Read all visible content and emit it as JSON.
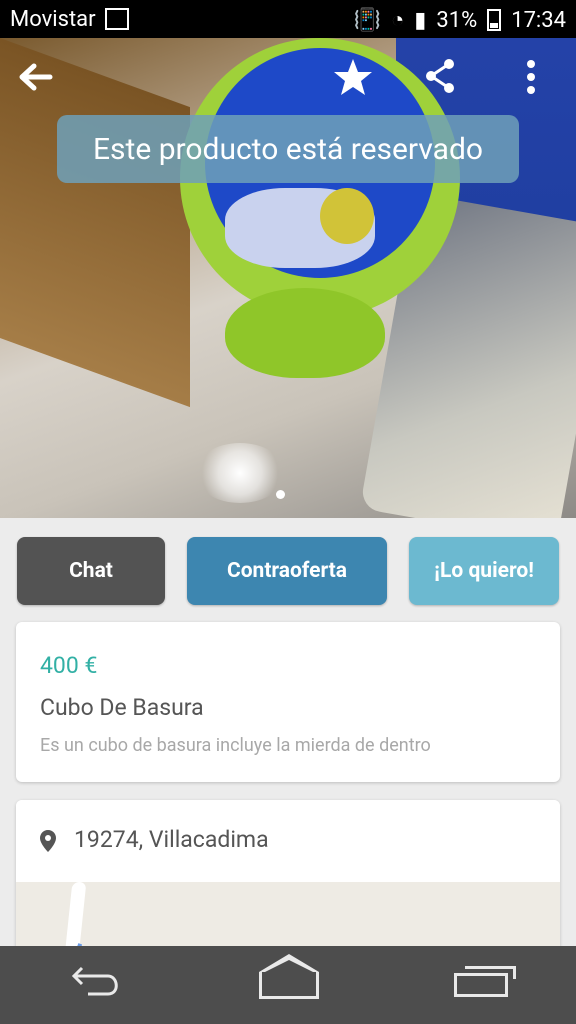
{
  "status_bar": {
    "carrier": "Movistar",
    "battery_percent": "31%",
    "time": "17:34"
  },
  "header": {
    "reserved_banner": "Este producto está reservado",
    "icons": [
      "back-arrow-icon",
      "star-icon",
      "share-icon",
      "more-vert-icon"
    ]
  },
  "actions": {
    "chat_label": "Chat",
    "counteroffer_label": "Contraoferta",
    "want_label": "¡Lo quiero!"
  },
  "product": {
    "price": "400 €",
    "title": "Cubo De Basura",
    "description": "Es un cubo de basura incluye la mierda de dentro"
  },
  "location": {
    "text": "19274, Villacadima"
  },
  "colors": {
    "price_teal": "#32b0a5",
    "chat_button": "#535353",
    "counteroffer_button": "#3d86b0",
    "want_button": "#6cb9d0"
  }
}
